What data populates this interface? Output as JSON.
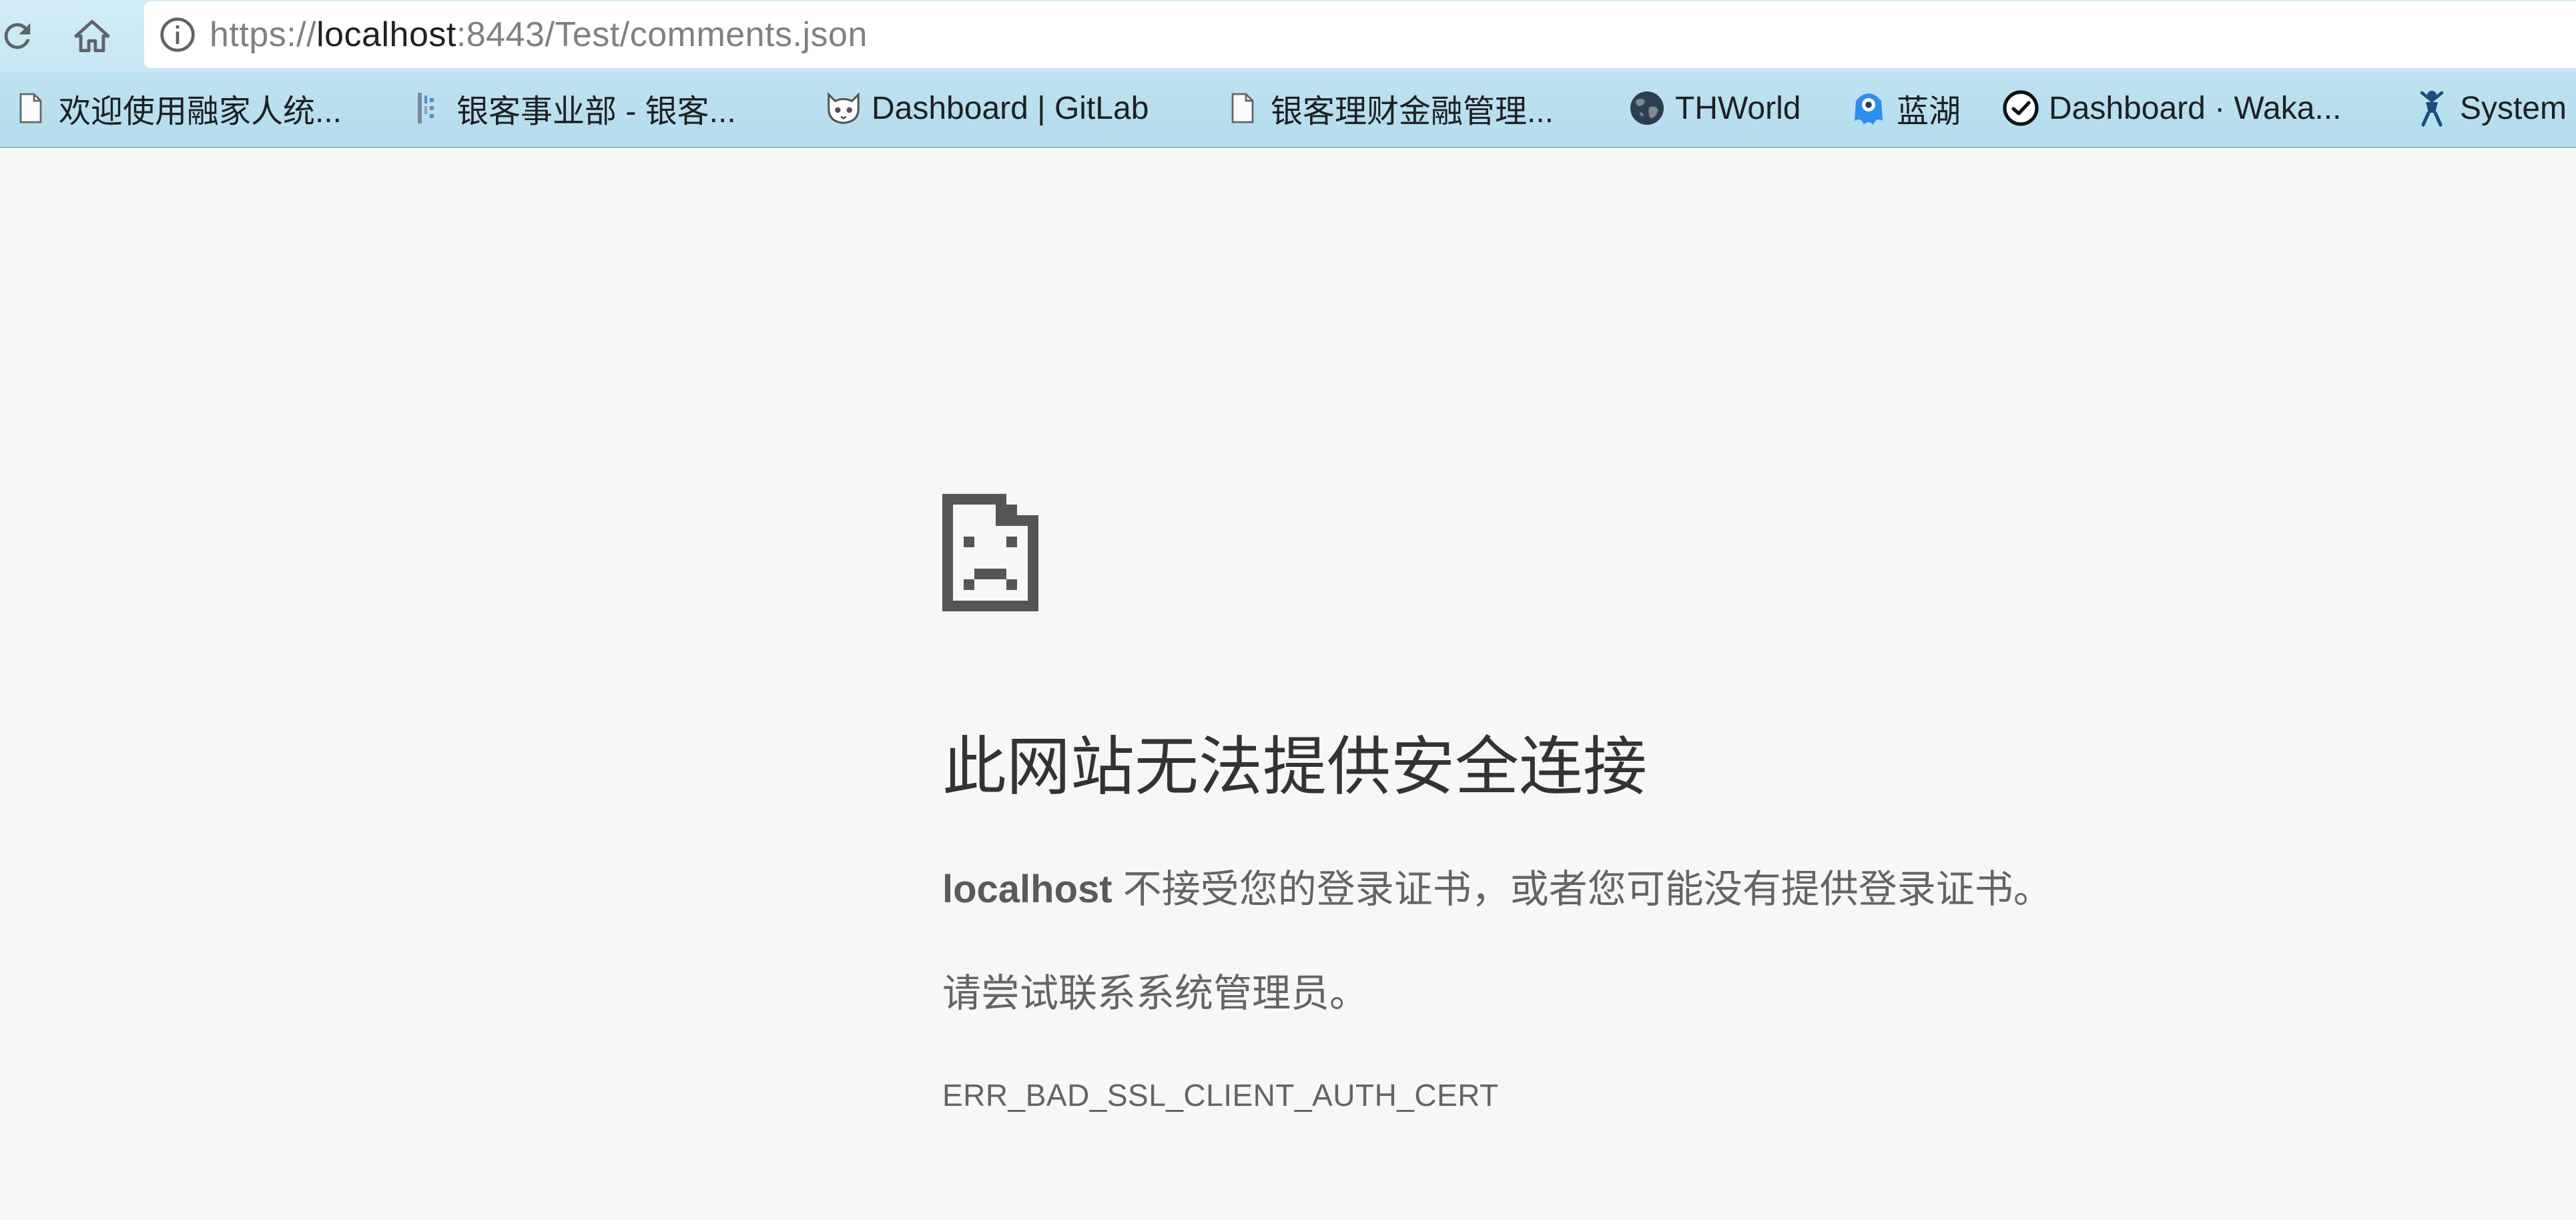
{
  "toolbar": {
    "url_scheme": "https://",
    "url_host": "localhost",
    "url_rest": ":8443/Test/comments.json",
    "reload_icon": "reload-icon",
    "home_icon": "home-icon",
    "info_icon": "info-icon"
  },
  "bookmarks": [
    {
      "label": "欢迎使用融家人统...",
      "icon": "page-icon"
    },
    {
      "label": "银客事业部 - 银客...",
      "icon": "confluence-icon"
    },
    {
      "label": "Dashboard | GitLab",
      "icon": "gitlab-icon"
    },
    {
      "label": "银客理财金融管理...",
      "icon": "page-icon"
    },
    {
      "label": "THWorld",
      "icon": "globe-icon"
    },
    {
      "label": "蓝湖",
      "icon": "lanhu-icon"
    },
    {
      "label": "Dashboard · Waka...",
      "icon": "clock-icon"
    },
    {
      "label": "System",
      "icon": "jenkins-icon"
    }
  ],
  "error": {
    "icon": "sad-page-icon",
    "title": "此网站无法提供安全连接",
    "host": "localhost",
    "description": " 不接受您的登录证书，或者您可能没有提供登录证书。",
    "suggestion": "请尝试联系系统管理员。",
    "code": "ERR_BAD_SSL_CLIENT_AUTH_CERT"
  },
  "colors": {
    "toolbar_bg": "#c6e6f2",
    "bookmarks_bg": "#b2dcec",
    "page_bg": "#f7f7f7",
    "title_text": "#333333",
    "body_text": "#646464"
  }
}
